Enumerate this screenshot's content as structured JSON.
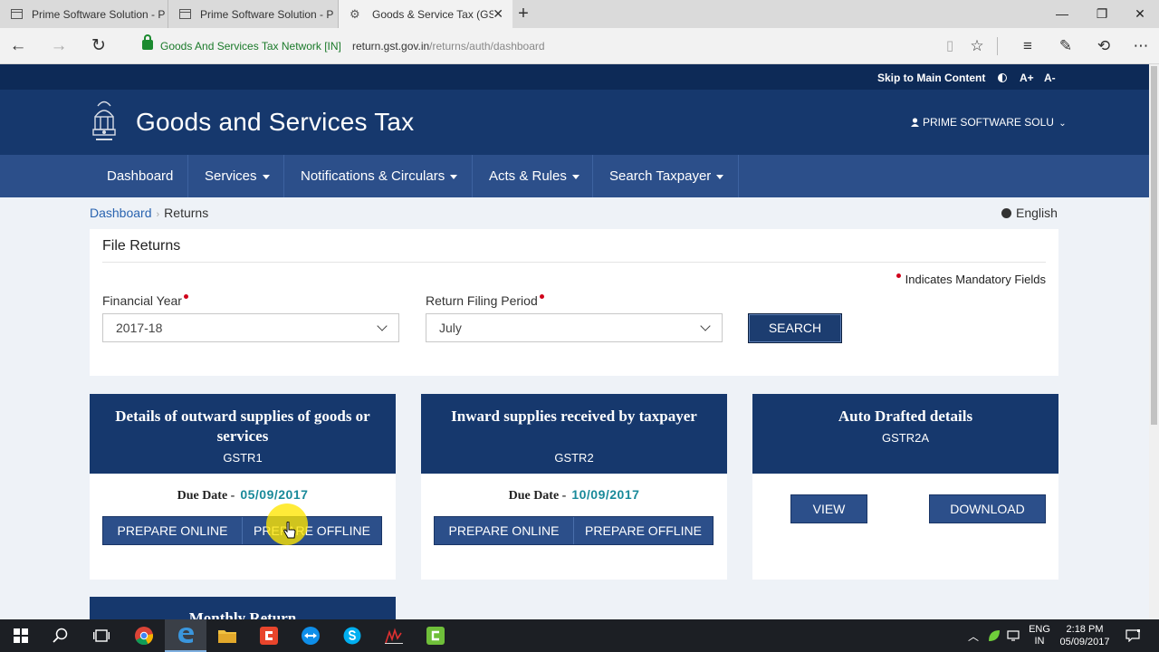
{
  "browser": {
    "tabs": [
      {
        "title": "Prime Software Solution - P",
        "active": false
      },
      {
        "title": "Prime Software Solution - P",
        "active": false
      },
      {
        "title": "Goods & Service Tax (GS",
        "active": true
      }
    ],
    "site_identity": "Goods And Services Tax Network [IN]",
    "url_host": "return.gst.gov.in",
    "url_path": "/returns/auth/dashboard"
  },
  "utility_bar": {
    "skip_link": "Skip to Main Content",
    "font_increase": "A+",
    "font_decrease": "A-"
  },
  "header": {
    "site_title": "Goods and Services Tax",
    "user_label": "PRIME SOFTWARE SOLU"
  },
  "nav": {
    "items": [
      {
        "label": "Dashboard",
        "has_dropdown": false
      },
      {
        "label": "Services",
        "has_dropdown": true
      },
      {
        "label": "Notifications & Circulars",
        "has_dropdown": true
      },
      {
        "label": "Acts & Rules",
        "has_dropdown": true
      },
      {
        "label": "Search Taxpayer",
        "has_dropdown": true
      }
    ]
  },
  "breadcrumb": {
    "home": "Dashboard",
    "current": "Returns"
  },
  "language": "English",
  "file_returns": {
    "title": "File Returns",
    "mandatory_note": "Indicates Mandatory Fields",
    "financial_year_label": "Financial Year",
    "financial_year_value": "2017-18",
    "period_label": "Return Filing Period",
    "period_value": "July",
    "search_label": "SEARCH"
  },
  "returns": [
    {
      "title": "Details of outward supplies of goods or services",
      "code": "GSTR1",
      "due_label": "Due Date -",
      "due_date": "05/09/2017",
      "primary_action": "PREPARE ONLINE",
      "secondary_action": "PREPARE OFFLINE"
    },
    {
      "title": "Inward supplies received by taxpayer",
      "code": "GSTR2",
      "due_label": "Due Date -",
      "due_date": "10/09/2017",
      "primary_action": "PREPARE ONLINE",
      "secondary_action": "PREPARE OFFLINE"
    },
    {
      "title": "Auto Drafted details",
      "code": "GSTR2A",
      "view_label": "VIEW",
      "download_label": "DOWNLOAD"
    }
  ],
  "partial_card_title": "Monthly Return",
  "taskbar": {
    "lang_top": "ENG",
    "lang_bottom": "IN",
    "time": "2:18 PM",
    "date": "05/09/2017"
  },
  "colors": {
    "header_navy": "#16386d",
    "nav_blue": "#2c4f8a",
    "due_date_teal": "#1a8a9a",
    "mandatory_red": "#d0021b"
  }
}
